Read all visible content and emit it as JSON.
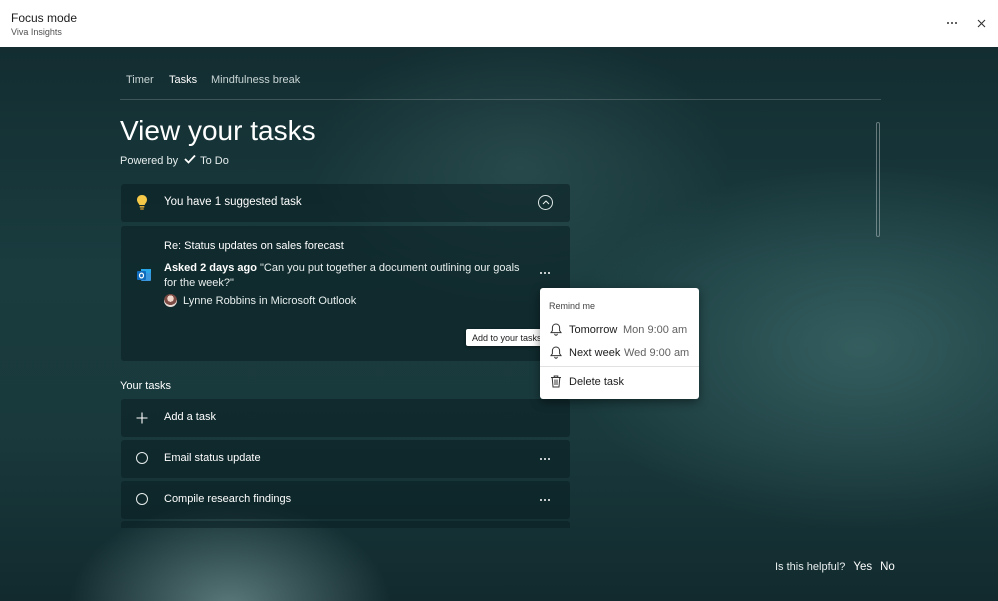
{
  "window": {
    "title": "Focus mode",
    "subtitle": "Viva Insights"
  },
  "tabs": [
    {
      "label": "Timer",
      "active": false
    },
    {
      "label": "Tasks",
      "active": true
    },
    {
      "label": "Mindfulness break",
      "active": false
    }
  ],
  "page": {
    "title": "View your tasks",
    "powered_by": "Powered by",
    "provider": "To Do"
  },
  "suggested": {
    "summary": "You have 1 suggested task",
    "item": {
      "subject": "Re: Status updates on sales forecast",
      "asked": "Asked 2 days ago",
      "quote": "\"Can you put together a document outlining our goals for the week?\"",
      "sender": "Lynne Robbins in Microsoft Outlook"
    },
    "tooltip": "Add to your tasks"
  },
  "menu": {
    "header": "Remind me",
    "items": [
      {
        "label": "Tomorrow",
        "time": "Mon 9:00 am",
        "icon": "bell-icon"
      },
      {
        "label": "Next week",
        "time": "Wed 9:00 am",
        "icon": "bell-icon"
      },
      {
        "label": "Delete task",
        "icon": "trash-icon"
      }
    ]
  },
  "your_tasks": {
    "label": "Your tasks",
    "add_label": "Add a task",
    "items": [
      {
        "title": "Email status update"
      },
      {
        "title": "Compile research findings"
      }
    ]
  },
  "feedback": {
    "question": "Is this helpful?",
    "yes": "Yes",
    "no": "No"
  },
  "colors": {
    "accent_outlook": "#0f6cbd",
    "bulb": "#f7c948",
    "background": "#1a3c3f"
  }
}
